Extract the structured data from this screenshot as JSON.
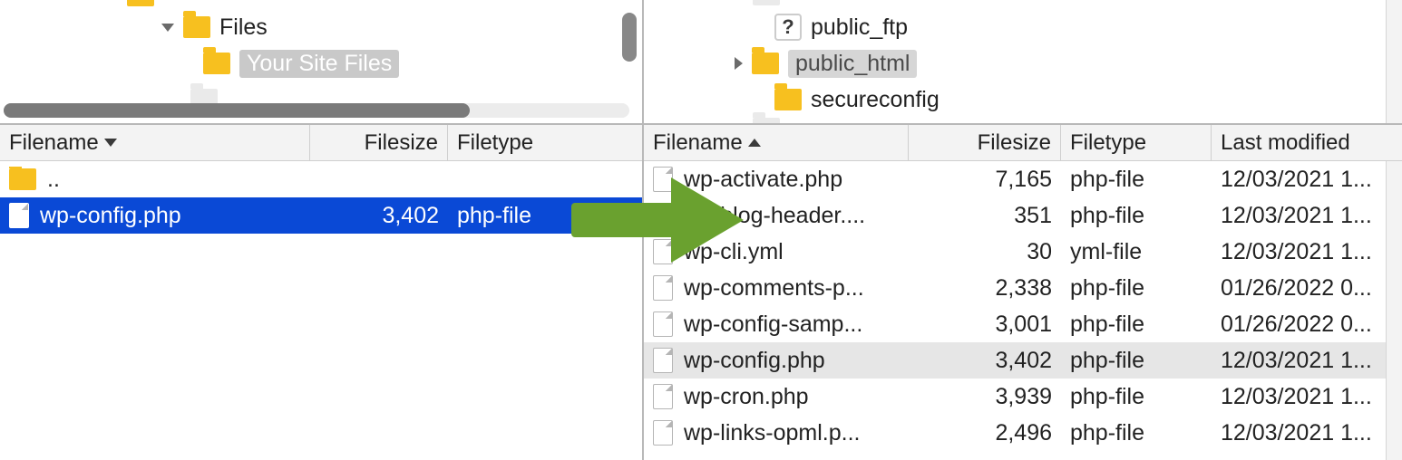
{
  "arrow_color": "#6aa12f",
  "left": {
    "tree": [
      {
        "indent": "lt-row1",
        "disclosure": "down",
        "icon": "folder",
        "label": "Files",
        "selected": false
      },
      {
        "indent": "lt-row2",
        "disclosure": "none",
        "icon": "folder",
        "label": "Your Site Files",
        "selected": true
      },
      {
        "indent": "lt-row3",
        "disclosure": "none",
        "icon": "folder-blank",
        "label": "",
        "selected": false
      }
    ],
    "columns": {
      "name": "Filename",
      "size": "Filesize",
      "type": "Filetype",
      "sort": "down"
    },
    "rows": [
      {
        "kind": "updir",
        "name": "..",
        "size": "",
        "type": "",
        "selected": false
      },
      {
        "kind": "file",
        "name": "wp-config.php",
        "size": "3,402",
        "type": "php-file",
        "selected": true
      }
    ]
  },
  "right": {
    "tree": [
      {
        "indent": "rt-row",
        "disclosure": "none",
        "icon": "question",
        "label": "public_ftp",
        "selected": false
      },
      {
        "indent": "rt-rowA",
        "disclosure": "right",
        "icon": "folder",
        "label": "public_html",
        "selected": true
      },
      {
        "indent": "rt-row",
        "disclosure": "none",
        "icon": "folder",
        "label": "secureconfig",
        "selected": false
      }
    ],
    "columns": {
      "name": "Filename",
      "size": "Filesize",
      "type": "Filetype",
      "mod": "Last modified",
      "sort": "up"
    },
    "rows": [
      {
        "name": "wp-activate.php",
        "size": "7,165",
        "type": "php-file",
        "mod": "12/03/2021 1...",
        "selected": false
      },
      {
        "name": "wp-blog-header....",
        "size": "351",
        "type": "php-file",
        "mod": "12/03/2021 1...",
        "selected": false
      },
      {
        "name": "wp-cli.yml",
        "size": "30",
        "type": "yml-file",
        "mod": "12/03/2021 1...",
        "selected": false
      },
      {
        "name": "wp-comments-p...",
        "size": "2,338",
        "type": "php-file",
        "mod": "01/26/2022 0...",
        "selected": false
      },
      {
        "name": "wp-config-samp...",
        "size": "3,001",
        "type": "php-file",
        "mod": "01/26/2022 0...",
        "selected": false
      },
      {
        "name": "wp-config.php",
        "size": "3,402",
        "type": "php-file",
        "mod": "12/03/2021 1...",
        "selected": true
      },
      {
        "name": "wp-cron.php",
        "size": "3,939",
        "type": "php-file",
        "mod": "12/03/2021 1...",
        "selected": false
      },
      {
        "name": "wp-links-opml.p...",
        "size": "2,496",
        "type": "php-file",
        "mod": "12/03/2021 1...",
        "selected": false
      }
    ]
  }
}
